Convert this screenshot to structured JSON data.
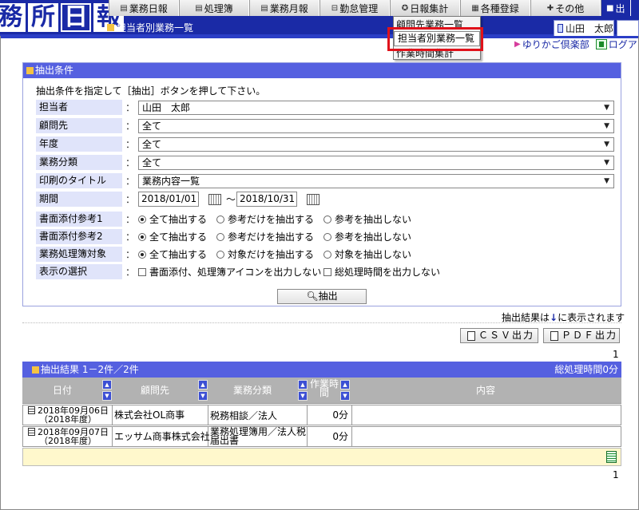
{
  "logo": [
    "務",
    "所",
    "日",
    "報"
  ],
  "topnav": [
    {
      "label": "業務日報",
      "icon": "calendar-icon"
    },
    {
      "label": "処理簿",
      "icon": "ledger-icon"
    },
    {
      "label": "業務月報",
      "icon": "calendar-icon"
    },
    {
      "label": "勤怠管理",
      "icon": "lock-icon"
    },
    {
      "label": "日報集計",
      "icon": "tally-icon"
    },
    {
      "label": "各種登録",
      "icon": "grid-icon"
    },
    {
      "label": "その他",
      "icon": "plus-icon"
    },
    {
      "label": "出",
      "icon": "exit-icon"
    }
  ],
  "page_title": "担当者別業務一覧",
  "user_tab": "山田　太郎",
  "dropdown": {
    "items": [
      "顧問先業務一覧",
      "担当者別業務一覧",
      "作業時間集計"
    ],
    "selected": "担当者別業務一覧"
  },
  "links": {
    "club": "ゆりかご倶楽部",
    "logout": "ログア"
  },
  "conditions": {
    "header": "抽出条件",
    "instruction": "抽出条件を指定して［抽出］ボタンを押して下さい。",
    "rows": [
      {
        "label": "担当者",
        "value": "山田　太郎"
      },
      {
        "label": "顧問先",
        "value": "全て"
      },
      {
        "label": "年度",
        "value": "全て"
      },
      {
        "label": "業務分類",
        "value": "全て"
      },
      {
        "label": "印刷のタイトル",
        "value": "業務内容一覧"
      }
    ],
    "period": {
      "label": "期間",
      "from": "2018/01/01",
      "to": "2018/10/31",
      "sep": "～"
    },
    "radio_rows": [
      {
        "label": "書面添付参考1",
        "options": [
          "全て抽出する",
          "参考だけを抽出する",
          "参考を抽出しない"
        ],
        "selected": 0
      },
      {
        "label": "書面添付参考2",
        "options": [
          "全て抽出する",
          "参考だけを抽出する",
          "参考を抽出しない"
        ],
        "selected": 0
      },
      {
        "label": "業務処理簿対象",
        "options": [
          "全て抽出する",
          "対象だけを抽出する",
          "対象を抽出しない"
        ],
        "selected": 0
      }
    ],
    "display": {
      "label": "表示の選択",
      "options": [
        "書面添付、処理簿アイコンを出力しない",
        "総処理時間を出力しない"
      ]
    },
    "colon": "：",
    "extract_button": "抽出"
  },
  "result_note": {
    "before": "抽出結果は",
    "arrow": "↓",
    "after": "に表示されます"
  },
  "buttons": {
    "csv": "ＣＳＶ出力",
    "pdf": "ＰＤＦ出力"
  },
  "page_number": "1",
  "results": {
    "header": "抽出結果 1－2件／2件",
    "total_time": "総処理時間0分",
    "columns": [
      "日付",
      "顧問先",
      "業務分類",
      "作業時間",
      "内容"
    ],
    "rows": [
      {
        "date": "2018年09月06日",
        "year": "（2018年度）",
        "client": "株式会社OL商事",
        "task": "税務相談／法人",
        "time": "0分",
        "content": ""
      },
      {
        "date": "2018年09月07日",
        "year": "（2018年度）",
        "client": "エッサム商事株式会社",
        "task": "業務処理簿用／法人税届出書",
        "time": "0分",
        "content": ""
      }
    ]
  }
}
